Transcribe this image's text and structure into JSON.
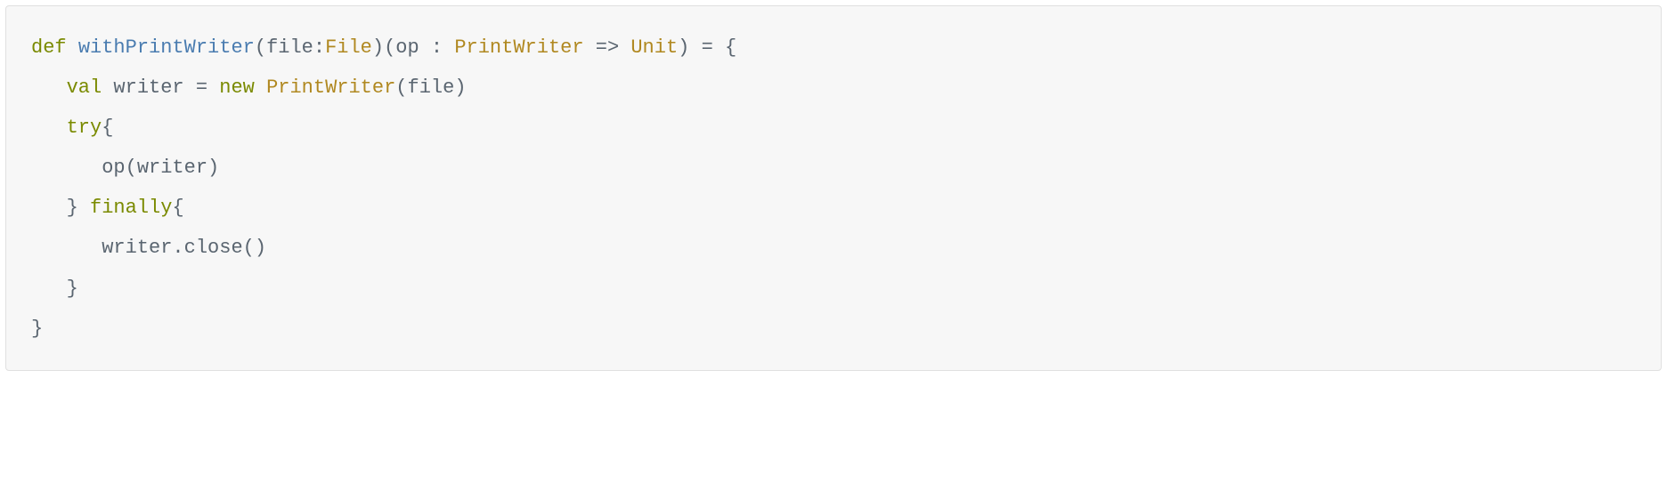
{
  "code": {
    "line1": {
      "def": "def",
      "fnName": "withPrintWriter",
      "lp1": "(",
      "param1": "file:",
      "type1": "File",
      "rp1": ")(",
      "param2": "op",
      "colon2": " : ",
      "type2": "PrintWriter",
      "arrow": " => ",
      "type3": "Unit",
      "rp2": ") = {"
    },
    "line2": {
      "indent": "   ",
      "val": "val",
      "space1": " ",
      "varName": "writer",
      "eq": " = ",
      "new": "new",
      "space2": " ",
      "type": "PrintWriter",
      "lp": "(",
      "arg": "file",
      "rp": ")"
    },
    "line3": {
      "indent": "   ",
      "try": "try",
      "brace": "{"
    },
    "line4": {
      "indent": "      ",
      "call": "op(writer)"
    },
    "line5": {
      "indent": "   ",
      "rbrace": "} ",
      "finally": "finally",
      "lbrace": "{"
    },
    "line6": {
      "indent": "      ",
      "call": "writer.close()"
    },
    "line7": {
      "indent": "   ",
      "brace": "}"
    },
    "line8": {
      "brace": "}"
    }
  }
}
